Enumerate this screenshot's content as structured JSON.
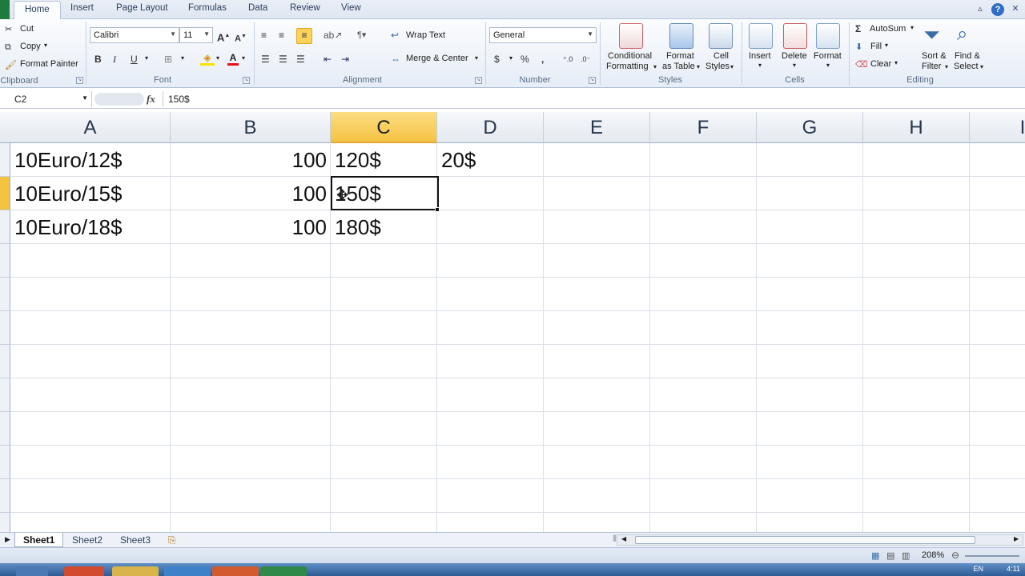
{
  "ribbon_tabs": [
    "Home",
    "Insert",
    "Page Layout",
    "Formulas",
    "Data",
    "Review",
    "View"
  ],
  "clipboard": {
    "cut": "Cut",
    "copy": "Copy",
    "format_painter": "Format Painter",
    "label": "Clipboard"
  },
  "font": {
    "family": "Calibri",
    "size": "11",
    "label": "Font",
    "bold": "B",
    "italic": "I",
    "underline": "U",
    "font_color_glyph": "A"
  },
  "alignment": {
    "wrap_text": "Wrap Text",
    "merge_center": "Merge & Center",
    "label": "Alignment"
  },
  "number": {
    "format": "General",
    "label": "Number",
    "currency": "$",
    "percent": "%",
    "comma": ","
  },
  "styles": {
    "conditional_1": "Conditional",
    "conditional_2": "Formatting",
    "table_1": "Format",
    "table_2": "as Table",
    "cell_1": "Cell",
    "cell_2": "Styles",
    "label": "Styles"
  },
  "cells": {
    "insert": "Insert",
    "delete": "Delete",
    "format": "Format",
    "label": "Cells"
  },
  "editing": {
    "autosum": "AutoSum",
    "fill": "Fill",
    "clear": "Clear",
    "sort_1": "Sort &",
    "sort_2": "Filter",
    "find_1": "Find &",
    "find_2": "Select",
    "label": "Editing",
    "sigma": "Σ"
  },
  "formula_bar": {
    "name_box": "C2",
    "fx": "fx",
    "value": "150$"
  },
  "columns": [
    "A",
    "B",
    "C",
    "D",
    "E",
    "F",
    "G",
    "H",
    "I"
  ],
  "selected_column": "C",
  "selected_row": 2,
  "rows": [
    {
      "A": "10Euro/12$",
      "B": "100",
      "C": "120$",
      "D": "20$"
    },
    {
      "A": "10Euro/15$",
      "B": "100",
      "C": "150$",
      "D": ""
    },
    {
      "A": "10Euro/18$",
      "B": "100",
      "C": "180$",
      "D": ""
    }
  ],
  "sheets": [
    "Sheet1",
    "Sheet2",
    "Sheet3"
  ],
  "active_sheet": "Sheet1",
  "status": {
    "zoom": "208%"
  },
  "taskbar": {
    "lang": "EN",
    "clock": "4:11"
  },
  "colors": {
    "excel_green": "#1f7a3d",
    "selection_gold": "#f5c342",
    "ribbon_blue": "#dfe7f2"
  }
}
